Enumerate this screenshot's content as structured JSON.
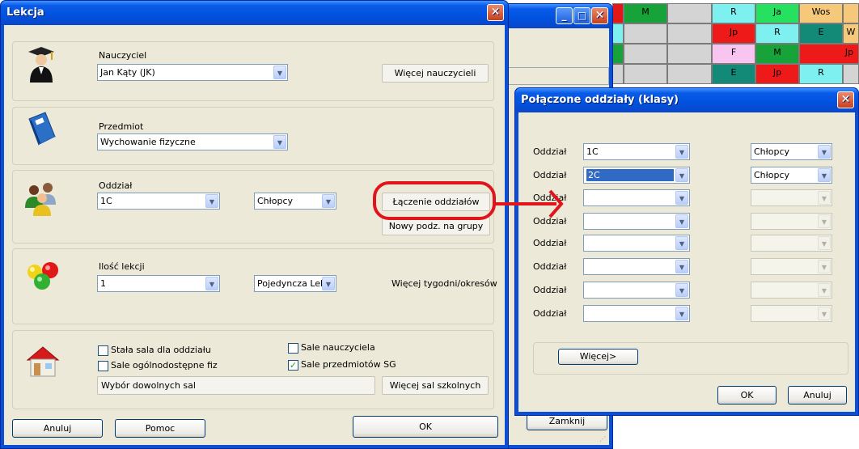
{
  "timetable": {
    "row1": [
      "M",
      "R",
      "Ja",
      "Wos"
    ],
    "row2": [
      "Jp",
      "R",
      "E",
      "W"
    ],
    "row3": [
      "F",
      "M",
      "Jp"
    ],
    "row4": [
      "E",
      "Jp",
      "R"
    ]
  },
  "bg_window": {
    "close_label": "Zamknij"
  },
  "lekcja": {
    "title": "Lekcja",
    "teacher": {
      "label": "Nauczyciel",
      "value": "Jan Kąty (JK)",
      "more_button": "Więcej nauczycieli"
    },
    "subject": {
      "label": "Przedmiot",
      "value": "Wychowanie fizyczne"
    },
    "class": {
      "label": "Oddział",
      "value": "1C",
      "group": "Chłopcy",
      "join_button": "Łączenie oddziałów",
      "split_button": "Nowy podz. na grupy"
    },
    "lessons": {
      "label": "Ilość lekcji",
      "value": "1",
      "type": "Pojedyncza Lekc",
      "more_weeks": "Więcej tygodni/okresów"
    },
    "rooms": {
      "fixed_room": "Stała sala dla oddziału",
      "general_rooms": "Sale ogólnodostępne fiz",
      "teacher_rooms": "Sale nauczyciela",
      "subject_rooms": "Sale przedmiotów SG",
      "any_rooms": "Wybór dowolnych sal",
      "more_rooms": "Więcej sal szkolnych"
    },
    "buttons": {
      "cancel": "Anuluj",
      "help": "Pomoc",
      "ok": "OK"
    }
  },
  "polaczone": {
    "title": "Połączone oddziały (klasy)",
    "row_label": "Oddział",
    "rows": [
      {
        "class": "1C",
        "group": "Chłopcy"
      },
      {
        "class": "2C",
        "group": "Chłopcy"
      },
      {
        "class": "",
        "group": ""
      },
      {
        "class": "",
        "group": ""
      },
      {
        "class": "",
        "group": ""
      },
      {
        "class": "",
        "group": ""
      },
      {
        "class": "",
        "group": ""
      },
      {
        "class": "",
        "group": ""
      }
    ],
    "more_button": "Więcej>",
    "ok": "OK",
    "cancel": "Anuluj"
  },
  "colors": {
    "annotation": "#e0141a",
    "xp_blue": "#0a4fd6"
  }
}
